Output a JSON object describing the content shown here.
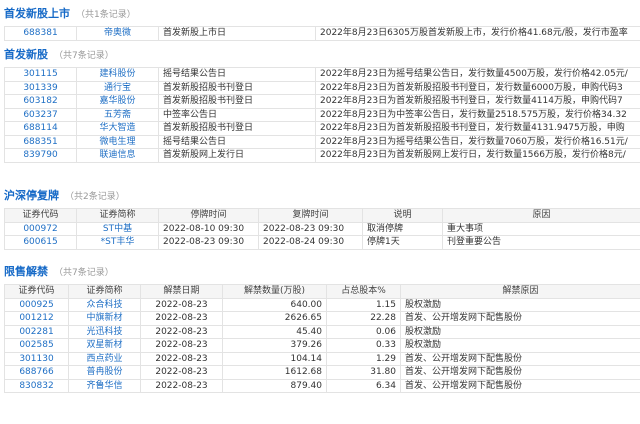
{
  "ipo_listing": {
    "title": "首发新股上市",
    "count": "（共1条记录）",
    "rows": [
      {
        "code": "688381",
        "name": "帝奥微",
        "event": "首发新股上市日",
        "detail": "2022年8月23日6305万股首发新股上市，发行价格41.68元/股，发行市盈率"
      }
    ]
  },
  "ipo_new": {
    "title": "首发新股",
    "count": "（共7条记录）",
    "rows": [
      {
        "code": "301115",
        "name": "建科股份",
        "event": "摇号结果公告日",
        "detail": "2022年8月23日为摇号结果公告日，发行数量4500万股，发行价格42.05元/"
      },
      {
        "code": "301339",
        "name": "通行宝",
        "event": "首发新股招股书刊登日",
        "detail": "2022年8月23日为首发新股招股书刊登日，发行数量6000万股，申购代码3"
      },
      {
        "code": "603182",
        "name": "嘉华股份",
        "event": "首发新股招股书刊登日",
        "detail": "2022年8月23日为首发新股招股书刊登日，发行数量4114万股，申购代码7"
      },
      {
        "code": "603237",
        "name": "五芳斋",
        "event": "中签率公告日",
        "detail": "2022年8月23日为中签率公告日，发行数量2518.575万股，发行价格34.32"
      },
      {
        "code": "688114",
        "name": "华大智造",
        "event": "首发新股招股书刊登日",
        "detail": "2022年8月23日为首发新股招股书刊登日，发行数量4131.9475万股，申购"
      },
      {
        "code": "688351",
        "name": "微电生理",
        "event": "摇号结果公告日",
        "detail": "2022年8月23日为摇号结果公告日，发行数量7060万股，发行价格16.51元/"
      },
      {
        "code": "839790",
        "name": "联迪信息",
        "event": "首发新股网上发行日",
        "detail": "2022年8月23日为首发新股网上发行日，发行数量1566万股，发行价格8元/"
      }
    ]
  },
  "suspension": {
    "title": "沪深停复牌",
    "count": "（共2条记录）",
    "headers": [
      "证券代码",
      "证券简称",
      "停牌时间",
      "复牌时间",
      "说明",
      "原因"
    ],
    "rows": [
      {
        "code": "000972",
        "name": "ST中基",
        "halt": "2022-08-10 09:30",
        "resume": "2022-08-23 09:30",
        "note": "取消停牌",
        "reason": "重大事项"
      },
      {
        "code": "600615",
        "name": "*ST丰华",
        "halt": "2022-08-23 09:30",
        "resume": "2022-08-24 09:30",
        "note": "停牌1天",
        "reason": "刊登重要公告"
      }
    ]
  },
  "unlock": {
    "title": "限售解禁",
    "count": "（共7条记录）",
    "headers": [
      "证券代码",
      "证券简称",
      "解禁日期",
      "解禁数量(万股)",
      "占总股本%",
      "解禁原因"
    ],
    "rows": [
      {
        "code": "000925",
        "name": "众合科技",
        "date": "2022-08-23",
        "qty": "640.00",
        "pct": "1.15",
        "reason": "股权激励"
      },
      {
        "code": "001212",
        "name": "中旗新材",
        "date": "2022-08-23",
        "qty": "2626.65",
        "pct": "22.28",
        "reason": "首发、公开增发网下配售股份"
      },
      {
        "code": "002281",
        "name": "光迅科技",
        "date": "2022-08-23",
        "qty": "45.40",
        "pct": "0.06",
        "reason": "股权激励"
      },
      {
        "code": "002585",
        "name": "双星新材",
        "date": "2022-08-23",
        "qty": "379.26",
        "pct": "0.33",
        "reason": "股权激励"
      },
      {
        "code": "301130",
        "name": "西点药业",
        "date": "2022-08-23",
        "qty": "104.14",
        "pct": "1.29",
        "reason": "首发、公开增发网下配售股份"
      },
      {
        "code": "688766",
        "name": "普冉股份",
        "date": "2022-08-23",
        "qty": "1612.68",
        "pct": "31.80",
        "reason": "首发、公开增发网下配售股份"
      },
      {
        "code": "830832",
        "name": "齐鲁华信",
        "date": "2022-08-23",
        "qty": "879.40",
        "pct": "6.34",
        "reason": "首发、公开增发网下配售股份"
      }
    ]
  }
}
